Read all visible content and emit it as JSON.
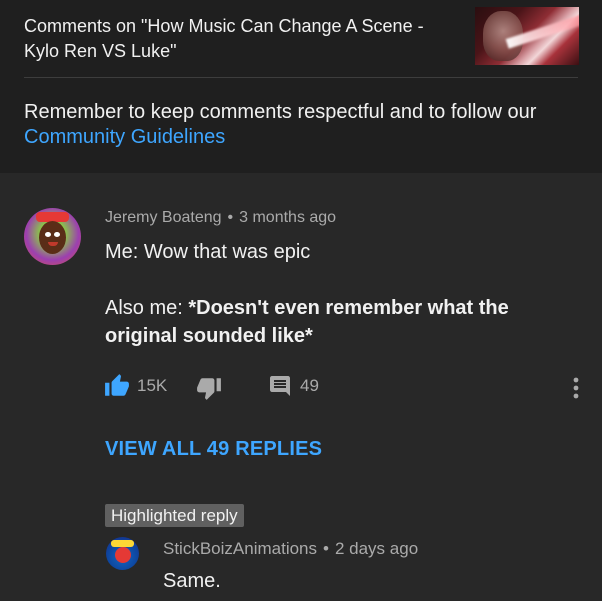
{
  "header": {
    "title": "Comments on \"How Music Can Change A Scene - Kylo Ren VS Luke\""
  },
  "notice": {
    "text": "Remember to keep comments respectful and to follow our",
    "link": "Community Guidelines"
  },
  "comment": {
    "author": "Jeremy Boateng",
    "separator": "•",
    "time": "3 months ago",
    "line1": "Me: Wow that was epic",
    "line2_prefix": "Also me: ",
    "line2_bold": "*Doesn't even remember what the original sounded like*",
    "likes": "15K",
    "replies": "49"
  },
  "view_replies": "VIEW ALL 49 REPLIES",
  "highlighted": {
    "badge": "Highlighted reply",
    "author": "StickBoizAnimations",
    "separator": "•",
    "time": "2 days ago",
    "text": "Same."
  },
  "icons": {
    "like": "thumbs-up-icon",
    "dislike": "thumbs-down-icon",
    "reply": "reply-bubble-icon",
    "more": "more-vertical-icon"
  },
  "colors": {
    "accent": "#3ea6ff",
    "background": "#282828",
    "header_bg": "#1f1f1f",
    "secondary_text": "#aaaaaa",
    "badge_bg": "#606060"
  }
}
